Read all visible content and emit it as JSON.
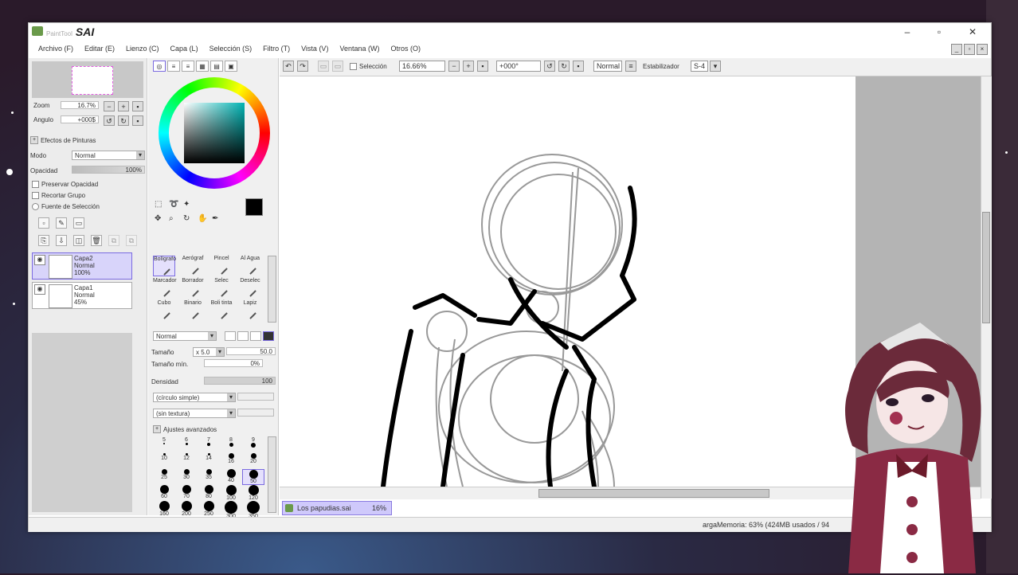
{
  "window": {
    "title_prefix": "PaintTool",
    "title": "SAI",
    "minimize": "–",
    "maximize": "▫",
    "close": "✕"
  },
  "menu": [
    "Archivo (F)",
    "Editar (E)",
    "Lienzo (C)",
    "Capa (L)",
    "Selección (S)",
    "Filtro (T)",
    "Vista (V)",
    "Ventana (W)",
    "Otros (O)"
  ],
  "navigator": {
    "zoom_label": "Zoom",
    "zoom_value": "16.7%",
    "angle_label": "Angulo",
    "angle_value": "+000$"
  },
  "layer_panel": {
    "effects_label": "Efectos de Pinturas",
    "mode_label": "Modo",
    "mode_value": "Normal",
    "opacity_label": "Opacidad",
    "opacity_value": "100%",
    "preserve_opacity": "Preservar Opacidad",
    "clip_group": "Recortar Grupo",
    "selection_source": "Fuente de Selección",
    "layers": [
      {
        "name": "Capa2",
        "mode": "Normal",
        "opacity": "100%",
        "selected": true
      },
      {
        "name": "Capa1",
        "mode": "Normal",
        "opacity": "45%",
        "selected": false
      }
    ]
  },
  "tools": {
    "brushes": [
      {
        "label": "Bolígrafo",
        "selected": true
      },
      {
        "label": "Aerógraf",
        "selected": false
      },
      {
        "label": "Pincel",
        "selected": false
      },
      {
        "label": "Al Agua",
        "selected": false
      },
      {
        "label": "Marcador",
        "selected": false
      },
      {
        "label": "Borrador",
        "selected": false
      },
      {
        "label": "Selec",
        "selected": false
      },
      {
        "label": "Deselec",
        "selected": false
      },
      {
        "label": "Cubo",
        "selected": false
      },
      {
        "label": "Binario",
        "selected": false
      },
      {
        "label": "Boli tinta",
        "selected": false
      },
      {
        "label": "Lapiz",
        "selected": false
      }
    ],
    "blend_mode": "Normal",
    "size_label": "Tamaño",
    "size_mult": "x 5.0",
    "size_value": "50.0",
    "min_size_label": "Tamaño mín.",
    "min_size_value": "0%",
    "density_label": "Densidad",
    "density_value": "100",
    "shape": "(círculo simple)",
    "texture": "(sin textura)",
    "advanced": "Ajustes avanzados",
    "dot_sizes": [
      [
        "5",
        "6",
        "7",
        "8",
        "9"
      ],
      [
        "10",
        "12",
        "14",
        "16",
        "20"
      ],
      [
        "25",
        "30",
        "35",
        "40",
        "50"
      ],
      [
        "60",
        "70",
        "80",
        "100",
        "120"
      ],
      [
        "160",
        "200",
        "250",
        "300",
        "350"
      ]
    ]
  },
  "canvas_toolbar": {
    "selection_label": "Selección",
    "zoom": "16.66%",
    "angle": "+000°",
    "mode": "Normal",
    "stabilizer_label": "Estabilizador",
    "stabilizer_value": "S-4"
  },
  "file_tab": {
    "name": "Los papudias.sai",
    "zoom": "16%"
  },
  "status": {
    "memory": "argaMemoria: 63% (424MB usados / 94"
  },
  "colors": {
    "primary": "#000000",
    "secondary": "#ffffff",
    "accent": "#7a6ae0"
  }
}
